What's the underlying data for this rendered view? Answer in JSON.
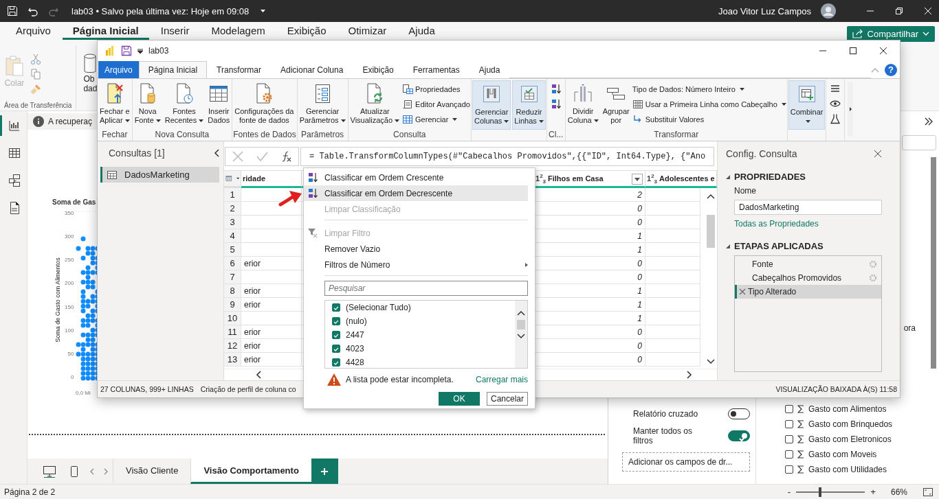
{
  "title_bar": {
    "title": "lab03 • Salvo pela última vez: Hoje em 09:08",
    "redo_disabled": true,
    "user_name": "Joao Vitor Luz Campos"
  },
  "menu_tabs": [
    {
      "label": "Arquivo",
      "selected": false
    },
    {
      "label": "Página Inicial",
      "selected": true
    },
    {
      "label": "Inserir",
      "selected": false
    },
    {
      "label": "Modelagem",
      "selected": false
    },
    {
      "label": "Exibição",
      "selected": false
    },
    {
      "label": "Otimizar",
      "selected": false
    },
    {
      "label": "Ajuda",
      "selected": false
    }
  ],
  "share_button": "Compartilhar",
  "ribbon": {
    "paste_button": "Colar",
    "paste_disabled": true,
    "group_label": "Área de Transferência",
    "next_button_lines": [
      "Ob",
      "dad"
    ]
  },
  "nav_items": [
    {
      "kind": "report",
      "selected": true
    },
    {
      "kind": "table",
      "selected": false
    },
    {
      "kind": "model",
      "selected": false
    },
    {
      "kind": "dax",
      "selected": false
    }
  ],
  "info_bar": "A recuperaç",
  "visual": {
    "title": "Soma de Gas",
    "y_axis_title": "Soma de Gasto com Alimentos",
    "y_ticks": [
      "350",
      "300",
      "250",
      "200",
      "150",
      "100",
      "50",
      "0"
    ],
    "x_tick": "0,0 Mi"
  },
  "page_tabs": [
    {
      "label": "Visão Cliente",
      "selected": false
    },
    {
      "label": "Visão Comportamento",
      "selected": true
    }
  ],
  "filters_pane": {
    "toggles": [
      {
        "label": "Relatório cruzado",
        "on": false
      },
      {
        "label": "Manter todos os filtros",
        "on": true
      }
    ],
    "drop_zone": "Adicionar os campos de dr..."
  },
  "fields_pane": {
    "cut_text": "ora",
    "fields": [
      {
        "label": "Gasto com Alimentos",
        "checked": false
      },
      {
        "label": "Gasto com Brinquedos",
        "checked": false
      },
      {
        "label": "Gasto com Eletronicos",
        "checked": false
      },
      {
        "label": "Gasto com Moveis",
        "checked": false
      },
      {
        "label": "Gasto com Utilidades",
        "checked": false
      }
    ]
  },
  "status_bar": {
    "page": "Página 2 de 2",
    "zoom_out": "-",
    "zoom_in": "+",
    "zoom": {
      "level": 0.35
    },
    "zoom_reading": "66%"
  },
  "query_editor": {
    "title": "lab03",
    "help_button": "?",
    "tabs": [
      {
        "label": "Arquivo",
        "kind": "file",
        "selected": false
      },
      {
        "label": "Página Inicial",
        "kind": "tab",
        "selected": true
      },
      {
        "label": "Transformar",
        "kind": "tab",
        "selected": false
      },
      {
        "label": "Adicionar Coluna",
        "kind": "tab",
        "selected": false
      },
      {
        "label": "Exibição",
        "kind": "tab",
        "selected": false
      },
      {
        "label": "Ferramentas",
        "kind": "tab",
        "selected": false
      },
      {
        "label": "Ajuda",
        "kind": "tab",
        "selected": false
      }
    ],
    "ribbon_groups": [
      {
        "label": "Fechar",
        "buttons": [
          {
            "kind": "apply",
            "lines": [
              "Fechar e",
              "Aplicar"
            ],
            "menu": true,
            "highlighted": false
          }
        ]
      },
      {
        "label": "Nova Consulta",
        "buttons": [
          {
            "kind": "new-source",
            "lines": [
              "Nova",
              "Fonte"
            ],
            "menu": true,
            "highlighted": false
          },
          {
            "kind": "recent",
            "lines": [
              "Fontes",
              "Recentes"
            ],
            "menu": true,
            "highlighted": false
          },
          {
            "kind": "enter-data",
            "lines": [
              "Inserir",
              "Dados"
            ],
            "menu": false,
            "highlighted": false
          }
        ]
      },
      {
        "label": "Fontes de Dados",
        "buttons": [
          {
            "kind": "source-settings",
            "lines": [
              "Configurações da",
              "fonte de dados"
            ],
            "menu": false,
            "highlighted": false
          }
        ]
      },
      {
        "label": "Parâmetros",
        "buttons": [
          {
            "kind": "parameters",
            "lines": [
              "Gerenciar",
              "Parâmetros"
            ],
            "menu": true,
            "highlighted": false
          }
        ]
      },
      {
        "label": "Consulta",
        "buttons": [
          {
            "kind": "refresh",
            "lines": [
              "Atualizar",
              "Visualização"
            ],
            "menu": true,
            "highlighted": false
          }
        ],
        "small": [
          {
            "kind": "properties",
            "label": "Propriedades",
            "menu": false
          },
          {
            "kind": "editor",
            "label": "Editor Avançado",
            "menu": false
          },
          {
            "kind": "manage",
            "label": "Gerenciar",
            "menu": true
          }
        ]
      },
      {
        "buttons": [
          {
            "kind": "columns",
            "lines": [
              "Gerenciar",
              "Colunas"
            ],
            "menu": true,
            "highlighted": true
          },
          {
            "kind": "rows",
            "lines": [
              "Reduzir",
              "Linhas"
            ],
            "menu": true,
            "highlighted": true
          }
        ]
      },
      {
        "label": "Cl...",
        "icons": [
          {
            "kind": "sort-asc"
          },
          {
            "kind": "sort-desc"
          }
        ]
      },
      {
        "label": "Transformar",
        "buttons": [
          {
            "kind": "split",
            "lines": [
              "Dividir",
              "Coluna"
            ],
            "menu": true,
            "highlighted": false
          },
          {
            "kind": "group-by",
            "lines": [
              "Agrupar",
              "por"
            ],
            "menu": false,
            "highlighted": false
          }
        ],
        "small": [
          {
            "kind": "data-type",
            "label": "Tipo de Dados: Número Inteiro",
            "menu": true
          },
          {
            "kind": "header-row",
            "label": "Usar a Primeira Linha como Cabeçalho",
            "menu": true
          },
          {
            "kind": "replace",
            "label": "Substituir Valores",
            "menu": false
          }
        ]
      },
      {
        "buttons": [
          {
            "kind": "combine",
            "lines": [
              "Combinar"
            ],
            "menu": true,
            "highlighted": true
          }
        ]
      },
      {
        "icons": [
          {
            "kind": "list"
          },
          {
            "kind": "eye"
          },
          {
            "kind": "flask"
          }
        ]
      }
    ],
    "queries": {
      "title": "Consultas [1]",
      "items": [
        {
          "name": "DadosMarketing",
          "selected": true
        }
      ]
    },
    "formula": "= Table.TransformColumnTypes(#\"Cabecalhos Promovidos\",{{\"ID\", Int64.Type}, {\"Ano",
    "columns": [
      {
        "label": "ridade",
        "filter_button": false
      },
      {
        "label": "Filhos em Casa",
        "type_label": "1$^{2}$$_{3}$",
        "filter_button": true
      },
      {
        "label": "Adolescentes e",
        "type_label": "1$^{2}$$_{3}$",
        "filter_button": false
      }
    ],
    "rows": [
      {
        "number": "1",
        "column_2": "2"
      },
      {
        "number": "2",
        "column_2": "0"
      },
      {
        "number": "3",
        "column_2": "0"
      },
      {
        "number": "4",
        "column_2": "1"
      },
      {
        "number": "5",
        "column_2": "1"
      },
      {
        "number": "6",
        "column_1": "erior",
        "column_2": "0"
      },
      {
        "number": "7",
        "column_2": "0"
      },
      {
        "number": "8",
        "column_1": "erior",
        "column_2": "1"
      },
      {
        "number": "9",
        "column_1": "erior",
        "column_2": "1"
      },
      {
        "number": "10",
        "column_2": "1"
      },
      {
        "number": "11",
        "column_1": "erior",
        "column_2": "0"
      },
      {
        "number": "12",
        "column_1": "erior",
        "column_2": "0"
      },
      {
        "number": "13",
        "column_1": "erior",
        "column_2": "0"
      }
    ],
    "column_menu": {
      "items": [
        {
          "kind": "sort-asc",
          "label": "Classificar em Ordem Crescente",
          "disabled": false,
          "highlighted": false
        },
        {
          "kind": "sort-desc",
          "label": "Classificar em Ordem Decrescente",
          "disabled": false,
          "highlighted": true
        },
        {
          "kind": "plain",
          "label": "Limpar Classificação",
          "disabled": true,
          "highlighted": false
        },
        {
          "kind": "clear-filter",
          "label": "Limpar Filtro",
          "disabled": true,
          "highlighted": false
        },
        {
          "kind": "plain",
          "label": "Remover Vazio",
          "disabled": false,
          "highlighted": false
        },
        {
          "kind": "submenu",
          "label": "Filtros de Número",
          "disabled": false,
          "highlighted": false
        }
      ],
      "search_placeholder": "Pesquisar",
      "values": [
        {
          "label": "(Selecionar Tudo)",
          "checked": true
        },
        {
          "label": "(nulo)",
          "checked": true
        },
        {
          "label": "2447",
          "checked": true
        },
        {
          "label": "4023",
          "checked": true
        },
        {
          "label": "4428",
          "checked": true
        }
      ],
      "warning": "A lista pode estar incompleta.",
      "load_more": "Carregar mais",
      "ok": "OK",
      "cancel": "Cancelar"
    },
    "settings": {
      "title": "Config. Consulta",
      "properties_heading": "PROPRIEDADES",
      "name_label": "Nome",
      "name_value": "DadosMarketing",
      "all_properties": "Todas as Propriedades",
      "steps_heading": "ETAPAS APLICADAS",
      "steps": [
        {
          "label": "Fonte",
          "has_settings": true,
          "selected": false
        },
        {
          "label": "Cabeçalhos Promovidos",
          "has_settings": true,
          "selected": false
        },
        {
          "label": "Tipo Alterado",
          "has_settings": false,
          "selected": true
        }
      ]
    },
    "status": {
      "columns_rows": "27 COLUNAS, 999+ LINHAS",
      "profiling": "Criação de perfil de coluna co",
      "preview": "VISUALIZAÇÃO BAIXADA À(S) 11:58"
    }
  }
}
